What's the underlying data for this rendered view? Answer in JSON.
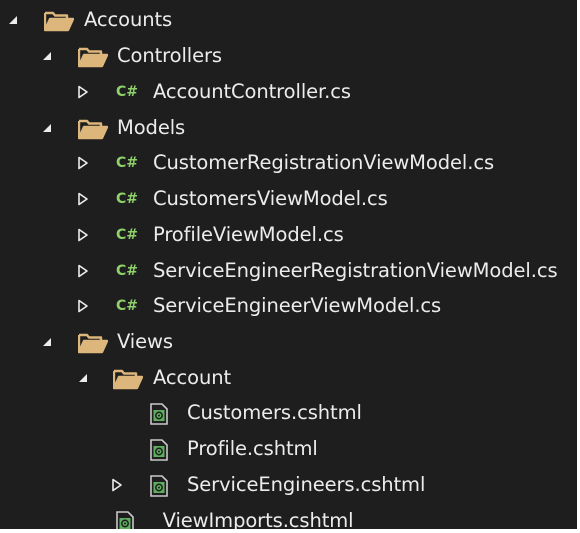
{
  "tree": [
    {
      "label": "Accounts",
      "type": "folder",
      "expanded": true,
      "icon": "folder-open-icon"
    },
    {
      "label": "Controllers",
      "type": "folder",
      "expanded": true,
      "icon": "folder-open-icon"
    },
    {
      "label": "AccountController.cs",
      "type": "csharp",
      "expanded": false,
      "icon": "csharp-file-icon",
      "icon_text": "C#"
    },
    {
      "label": "Models",
      "type": "folder",
      "expanded": true,
      "icon": "folder-open-icon"
    },
    {
      "label": "CustomerRegistrationViewModel.cs",
      "type": "csharp",
      "expanded": false,
      "icon": "csharp-file-icon",
      "icon_text": "C#"
    },
    {
      "label": "CustomersViewModel.cs",
      "type": "csharp",
      "expanded": false,
      "icon": "csharp-file-icon",
      "icon_text": "C#"
    },
    {
      "label": "ProfileViewModel.cs",
      "type": "csharp",
      "expanded": false,
      "icon": "csharp-file-icon",
      "icon_text": "C#"
    },
    {
      "label": "ServiceEngineerRegistrationViewModel.cs",
      "type": "csharp",
      "expanded": false,
      "icon": "csharp-file-icon",
      "icon_text": "C#"
    },
    {
      "label": "ServiceEngineerViewModel.cs",
      "type": "csharp",
      "expanded": false,
      "icon": "csharp-file-icon",
      "icon_text": "C#"
    },
    {
      "label": "Views",
      "type": "folder",
      "expanded": true,
      "icon": "folder-open-icon"
    },
    {
      "label": "Account",
      "type": "folder",
      "expanded": true,
      "icon": "folder-open-icon"
    },
    {
      "label": "Customers.cshtml",
      "type": "razor",
      "icon": "razor-file-icon"
    },
    {
      "label": "Profile.cshtml",
      "type": "razor",
      "icon": "razor-file-icon"
    },
    {
      "label": "ServiceEngineers.cshtml",
      "type": "razor",
      "expanded": false,
      "icon": "razor-file-icon"
    },
    {
      "label": "_ViewImports.cshtml",
      "type": "razor",
      "icon": "razor-file-icon"
    }
  ],
  "colors": {
    "background": "#1e1e1e",
    "text": "#ececec",
    "folder": "#dcb67a",
    "csharp": "#8fd16b",
    "razor": "#5fae5f"
  }
}
